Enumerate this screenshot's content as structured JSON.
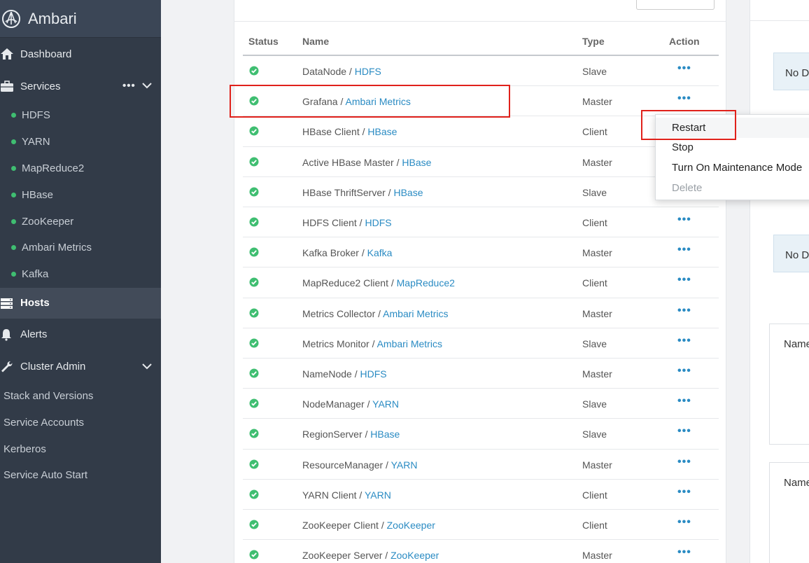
{
  "sidebar": {
    "brand": "Ambari",
    "nav": {
      "dashboard": "Dashboard",
      "services": "Services",
      "services_more": "•••",
      "hosts": "Hosts",
      "alerts": "Alerts",
      "cluster_admin": "Cluster Admin"
    },
    "services": [
      "HDFS",
      "YARN",
      "MapReduce2",
      "HBase",
      "ZooKeeper",
      "Ambari Metrics",
      "Kafka"
    ],
    "cluster_admin_items": [
      "Stack and Versions",
      "Service Accounts",
      "Kerberos",
      "Service Auto Start"
    ]
  },
  "table": {
    "headers": {
      "status": "Status",
      "name": "Name",
      "type": "Type",
      "action": "Action"
    },
    "rows": [
      {
        "component": "DataNode",
        "service": "HDFS",
        "type": "Slave"
      },
      {
        "component": "Grafana",
        "service": "Ambari Metrics",
        "type": "Master"
      },
      {
        "component": "HBase Client",
        "service": "HBase",
        "type": "Client"
      },
      {
        "component": "Active HBase Master",
        "service": "HBase",
        "type": "Master"
      },
      {
        "component": "HBase ThriftServer",
        "service": "HBase",
        "type": "Slave"
      },
      {
        "component": "HDFS Client",
        "service": "HDFS",
        "type": "Client"
      },
      {
        "component": "Kafka Broker",
        "service": "Kafka",
        "type": "Master"
      },
      {
        "component": "MapReduce2 Client",
        "service": "MapReduce2",
        "type": "Client"
      },
      {
        "component": "Metrics Collector",
        "service": "Ambari Metrics",
        "type": "Master"
      },
      {
        "component": "Metrics Monitor",
        "service": "Ambari Metrics",
        "type": "Slave"
      },
      {
        "component": "NameNode",
        "service": "HDFS",
        "type": "Master"
      },
      {
        "component": "NodeManager",
        "service": "YARN",
        "type": "Slave"
      },
      {
        "component": "RegionServer",
        "service": "HBase",
        "type": "Slave"
      },
      {
        "component": "ResourceManager",
        "service": "YARN",
        "type": "Master"
      },
      {
        "component": "YARN Client",
        "service": "YARN",
        "type": "Client"
      },
      {
        "component": "ZooKeeper Client",
        "service": "ZooKeeper",
        "type": "Client"
      },
      {
        "component": "ZooKeeper Server",
        "service": "ZooKeeper",
        "type": "Master"
      }
    ],
    "separator": " / ",
    "action_glyph": "•••"
  },
  "dropdown": {
    "items": [
      {
        "label": "Restart",
        "enabled": true
      },
      {
        "label": "Stop",
        "enabled": true
      },
      {
        "label": "Turn On Maintenance Mode",
        "enabled": true
      },
      {
        "label": "Delete",
        "enabled": false
      }
    ]
  },
  "right_panel": {
    "no_data_1": "No D",
    "no_data_2": "No D",
    "name_1": "Name",
    "name_2": "Name"
  },
  "colors": {
    "sidebar_bg": "#323b48",
    "status_ok": "#3fbe71",
    "link": "#2a8bc3",
    "highlight": "#e0211b"
  }
}
